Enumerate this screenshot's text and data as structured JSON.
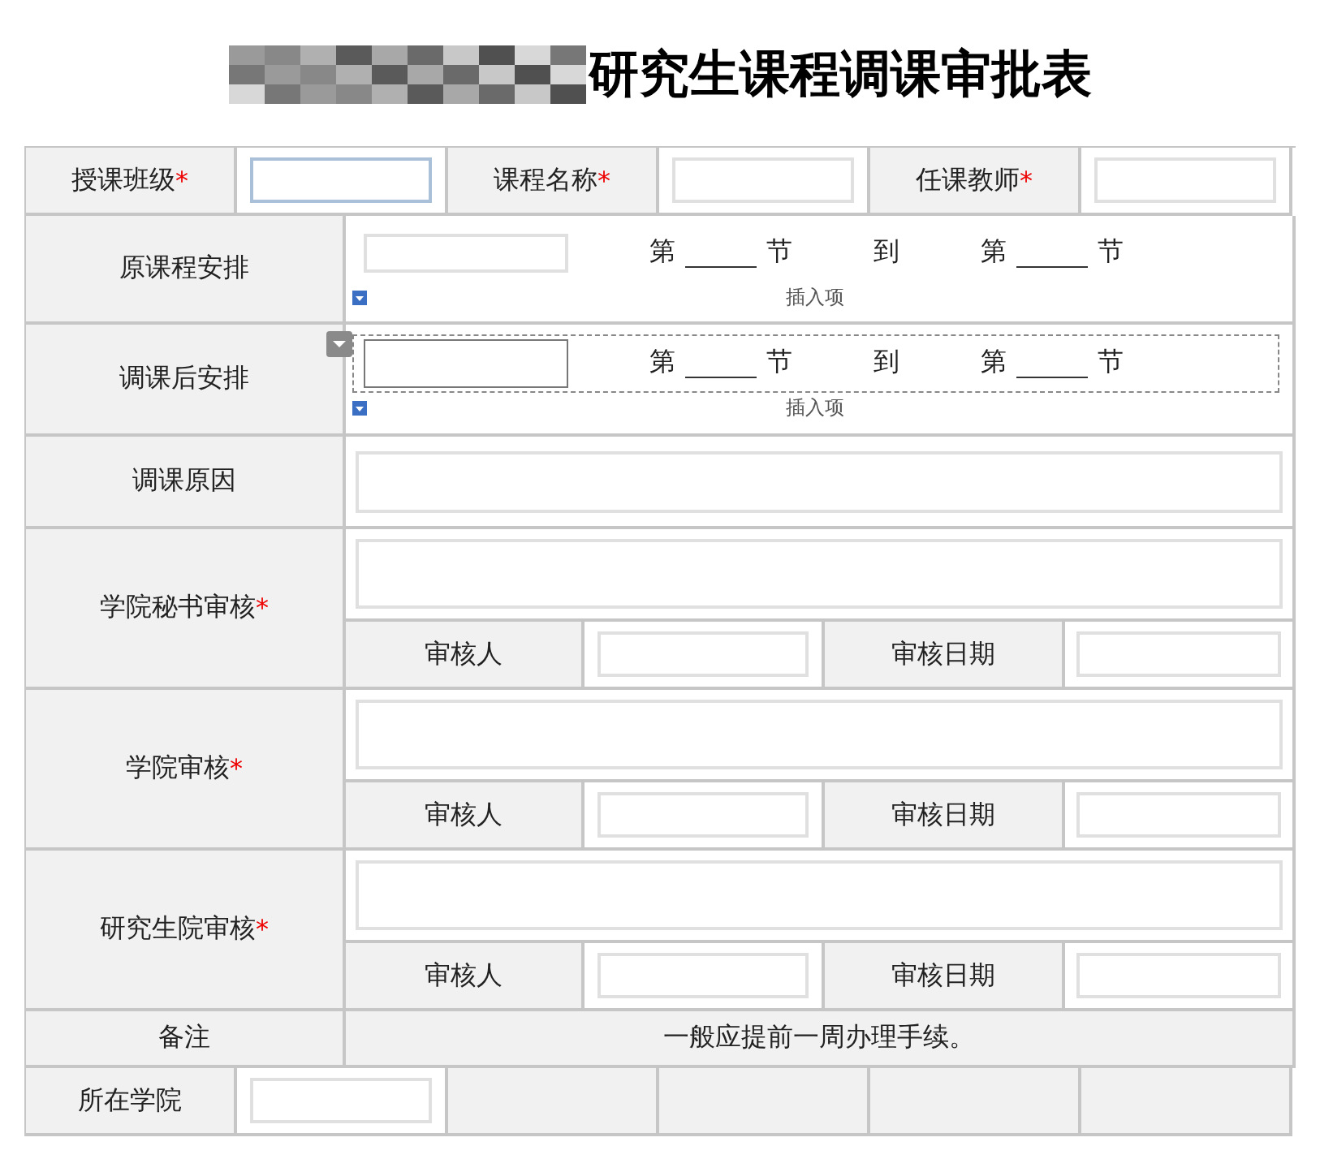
{
  "title": "研究生课程调课审批表",
  "header_fields": [
    {
      "label": "授课班级",
      "required_mark": "*",
      "focused": true
    },
    {
      "label": "课程名称",
      "required_mark": "*",
      "focused": false
    },
    {
      "label": "任课教师",
      "required_mark": "*",
      "focused": false
    }
  ],
  "schedule_rows": [
    {
      "label": "原课程安排",
      "from": {
        "prefix": "第",
        "suffix": "节"
      },
      "to_word": "到",
      "to": {
        "prefix": "第",
        "suffix": "节"
      },
      "insert_label": "插入项",
      "selected": false
    },
    {
      "label": "调课后安排",
      "from": {
        "prefix": "第",
        "suffix": "节"
      },
      "to_word": "到",
      "to": {
        "prefix": "第",
        "suffix": "节"
      },
      "insert_label": "插入项",
      "selected": true
    }
  ],
  "reason": {
    "label": "调课原因"
  },
  "approvals": [
    {
      "label": "学院秘书审核",
      "required_mark": "*",
      "reviewer_label": "审核人",
      "date_label": "审核日期"
    },
    {
      "label": "学院审核",
      "required_mark": "*",
      "reviewer_label": "审核人",
      "date_label": "审核日期"
    },
    {
      "label": "研究生院审核",
      "required_mark": "*",
      "reviewer_label": "审核人",
      "date_label": "审核日期"
    }
  ],
  "remarks": {
    "label": "备注",
    "text": "一般应提前一周办理手续。"
  },
  "college": {
    "label": "所在学院"
  }
}
